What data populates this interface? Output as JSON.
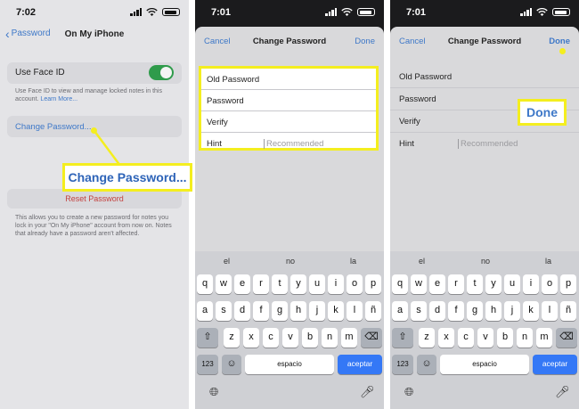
{
  "colors": {
    "accent": "#3e78c8",
    "highlight": "#f4ee1f",
    "toggle_on": "#2f9b4b",
    "destructive": "#c3423f",
    "keyboard_action": "#3478f6"
  },
  "panel1": {
    "time": "7:02",
    "back_label": "Password",
    "nav_title": "On My iPhone",
    "face_id_label": "Use Face ID",
    "face_id_on": true,
    "face_id_note": "Use Face ID to view and manage locked notes in this account.",
    "learn_more": "Learn More...",
    "change_password": "Change Password...",
    "reset_password": "Reset Password",
    "reset_note": "This allows you to create a new password for notes you lock in your \"On My iPhone\" account from now on. Notes that already have a password aren't affected.",
    "callout": "Change Password..."
  },
  "panel2": {
    "time": "7:01",
    "cancel": "Cancel",
    "title": "Change Password",
    "done": "Done",
    "fields": [
      {
        "label": "Old Password",
        "placeholder": ""
      },
      {
        "label": "Password",
        "placeholder": ""
      },
      {
        "label": "Verify",
        "placeholder": ""
      },
      {
        "label": "Hint",
        "placeholder": "Recommended"
      }
    ]
  },
  "panel3": {
    "time": "7:01",
    "cancel": "Cancel",
    "title": "Change Password",
    "done": "Done",
    "callout": "Done",
    "fields": [
      {
        "label": "Old Password",
        "placeholder": ""
      },
      {
        "label": "Password",
        "placeholder": ""
      },
      {
        "label": "Verify",
        "placeholder": ""
      },
      {
        "label": "Hint",
        "placeholder": "Recommended"
      }
    ]
  },
  "keyboard": {
    "suggestions": [
      "el",
      "no",
      "la"
    ],
    "row1": [
      "q",
      "w",
      "e",
      "r",
      "t",
      "y",
      "u",
      "i",
      "o",
      "p"
    ],
    "row2": [
      "a",
      "s",
      "d",
      "f",
      "g",
      "h",
      "j",
      "k",
      "l",
      "ñ"
    ],
    "row3": [
      "z",
      "x",
      "c",
      "v",
      "b",
      "n",
      "m"
    ],
    "shift_icon": "shift-icon",
    "delete_icon": "delete-icon",
    "numbers": "123",
    "emoji_icon": "emoji-icon",
    "space": "espacio",
    "action": "aceptar",
    "globe_icon": "globe-icon",
    "mic_icon": "microphone-icon"
  }
}
